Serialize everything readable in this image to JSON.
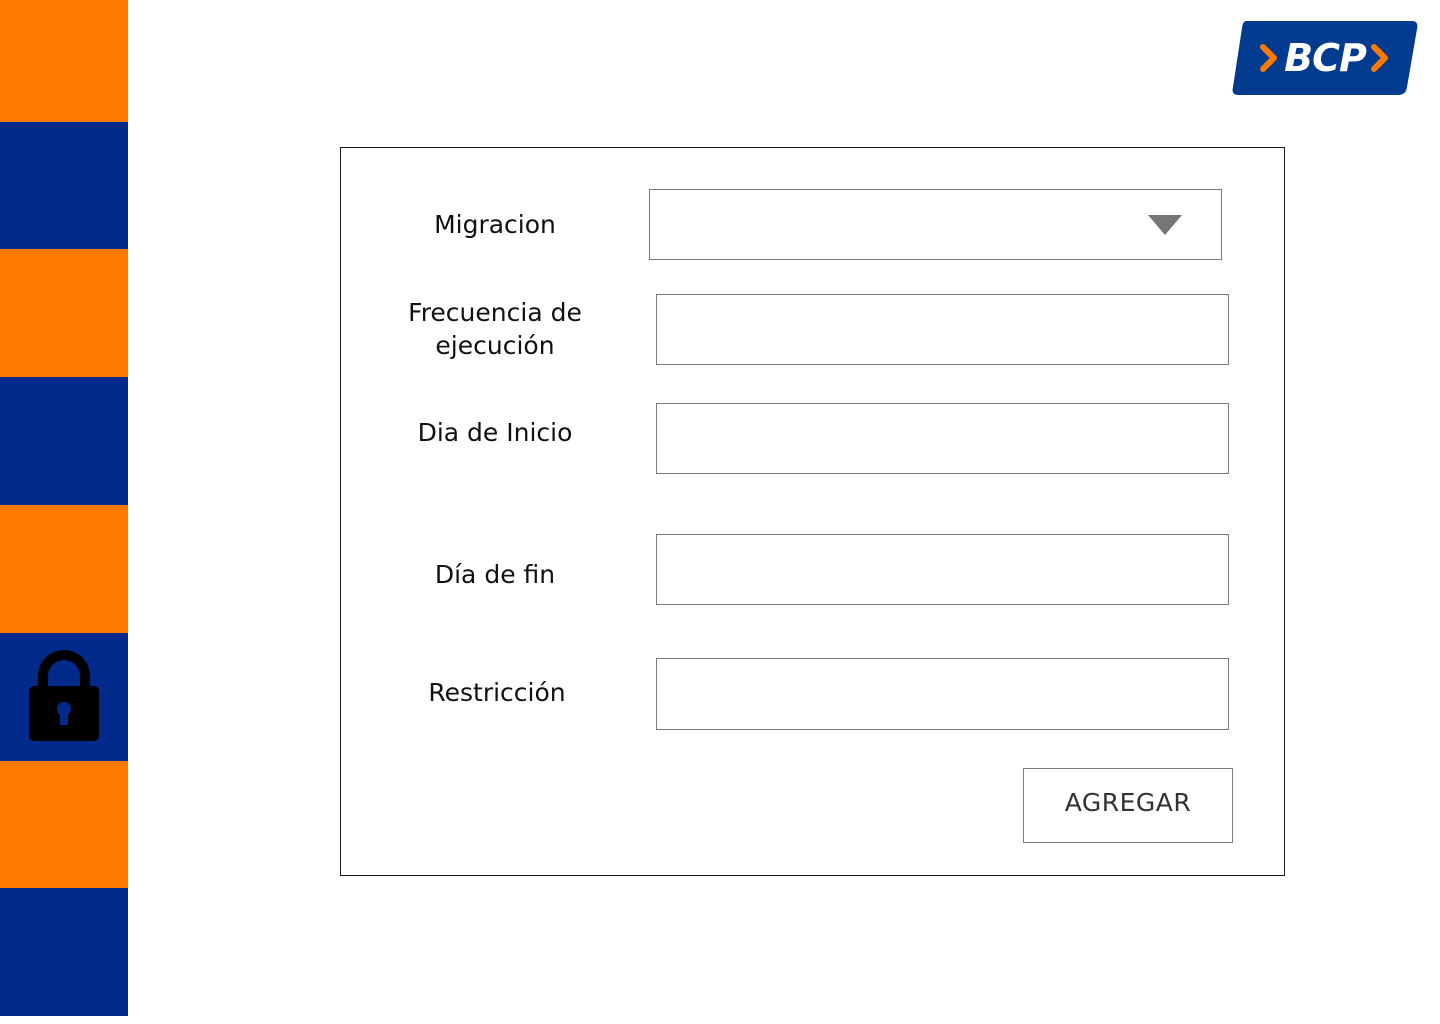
{
  "brand": {
    "logo_text": "BCP",
    "colors": {
      "orange": "#ff7a00",
      "blue": "#012a8a",
      "logo_blue": "#003b8f",
      "logo_orange": "#ff7a00"
    }
  },
  "sidebar": {
    "icon": "lock-icon"
  },
  "form": {
    "migracion": {
      "label": "Migracion",
      "value": ""
    },
    "frecuencia": {
      "label_line1": "Frecuencia de",
      "label_line2": "ejecución",
      "value": ""
    },
    "dia_inicio": {
      "label": "Dia de Inicio",
      "value": ""
    },
    "dia_fin": {
      "label": "Día de fin",
      "value": ""
    },
    "restriccion": {
      "label": "Restricción",
      "value": ""
    },
    "submit_label": "AGREGAR"
  }
}
